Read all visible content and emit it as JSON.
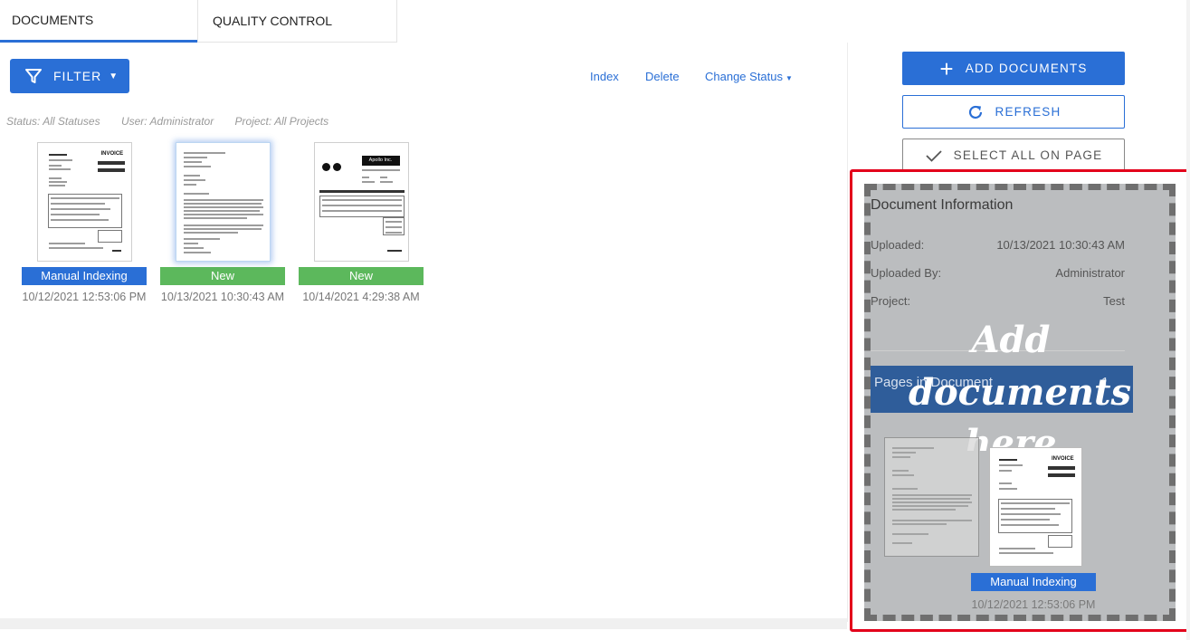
{
  "tabs": [
    {
      "label": "DOCUMENTS",
      "active": true
    },
    {
      "label": "QUALITY CONTROL",
      "active": false
    }
  ],
  "toolbar": {
    "filter_label": "FILTER",
    "filter_icon": "funnel-icon",
    "links": {
      "index": "Index",
      "delete": "Delete",
      "change_status": "Change Status"
    }
  },
  "filters": {
    "status": "Status: All Statuses",
    "user": "User: Administrator",
    "project": "Project: All Projects"
  },
  "documents": [
    {
      "thumb_heading": "INVOICE",
      "status": "Manual Indexing",
      "status_color": "#2a6fd6",
      "date": "10/12/2021 12:53:06 PM"
    },
    {
      "thumb_heading": "",
      "status": "New",
      "status_color": "#5cb85c",
      "date": "10/13/2021 10:30:43 AM"
    },
    {
      "thumb_heading": "Apollo Inc.",
      "status": "New",
      "status_color": "#5cb85c",
      "date": "10/14/2021 4:29:38 AM"
    }
  ],
  "actions": {
    "add_documents": "ADD DOCUMENTS",
    "refresh": "REFRESH",
    "select_all": "SELECT ALL ON PAGE"
  },
  "doc_info": {
    "title": "Document Information",
    "uploaded_label": "Uploaded:",
    "uploaded_value": "10/13/2021 10:30:43 AM",
    "uploaded_by_label": "Uploaded By:",
    "uploaded_by_value": "Administrator",
    "project_label": "Project:",
    "project_value": "Test",
    "pages_label": "Pages in Document",
    "pages_value": "1"
  },
  "dropzone": {
    "line1": "Add",
    "line2": "documents",
    "line3": "here",
    "drag_status": "Manual Indexing",
    "drag_date": "10/12/2021 12:53:06 PM",
    "drag_heading": "INVOICE"
  },
  "colors": {
    "accent": "#2a6fd6",
    "new": "#5cb85c",
    "highlight": "#e3001b"
  }
}
